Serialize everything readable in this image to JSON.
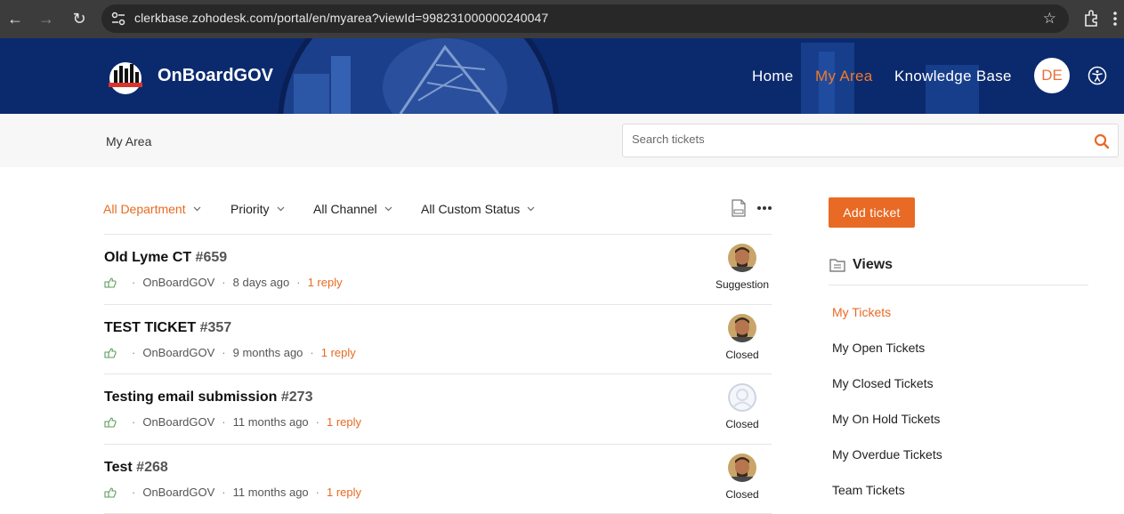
{
  "browser": {
    "url": "clerkbase.zohodesk.com/portal/en/myarea?viewId=998231000000240047"
  },
  "header": {
    "brand": "OnBoardGOV",
    "nav": [
      {
        "label": "Home",
        "active": false
      },
      {
        "label": "My Area",
        "active": true
      },
      {
        "label": "Knowledge Base",
        "active": false
      }
    ],
    "user_initials": "DE",
    "accent": "#f07a2a",
    "banner_color": "#0d2f7a"
  },
  "subheader": {
    "breadcrumb": "My Area",
    "search_placeholder": "Search tickets"
  },
  "filters": [
    {
      "label": "All Department",
      "active": true
    },
    {
      "label": "Priority",
      "active": false
    },
    {
      "label": "All Channel",
      "active": false
    },
    {
      "label": "All Custom Status",
      "active": false
    }
  ],
  "tickets": [
    {
      "title": "Old Lyme CT",
      "number": "#659",
      "department": "OnBoardGOV",
      "time": "8 days ago",
      "replies": "1 reply",
      "status": "Suggestion",
      "avatar": "photo"
    },
    {
      "title": "TEST TICKET",
      "number": "#357",
      "department": "OnBoardGOV",
      "time": "9 months ago",
      "replies": "1 reply",
      "status": "Closed",
      "avatar": "photo"
    },
    {
      "title": "Testing email submission",
      "number": "#273",
      "department": "OnBoardGOV",
      "time": "11 months ago",
      "replies": "1 reply",
      "status": "Closed",
      "avatar": "placeholder"
    },
    {
      "title": "Test",
      "number": "#268",
      "department": "OnBoardGOV",
      "time": "11 months ago",
      "replies": "1 reply",
      "status": "Closed",
      "avatar": "photo"
    }
  ],
  "sidebar": {
    "add_ticket_label": "Add ticket",
    "views_title": "Views",
    "views": [
      {
        "label": "My Tickets",
        "active": true
      },
      {
        "label": "My Open Tickets",
        "active": false
      },
      {
        "label": "My Closed Tickets",
        "active": false
      },
      {
        "label": "My On Hold Tickets",
        "active": false
      },
      {
        "label": "My Overdue Tickets",
        "active": false
      },
      {
        "label": "Team Tickets",
        "active": false
      }
    ]
  },
  "colors": {
    "accent": "#e86a24",
    "chrome": "#3c3c3c"
  }
}
